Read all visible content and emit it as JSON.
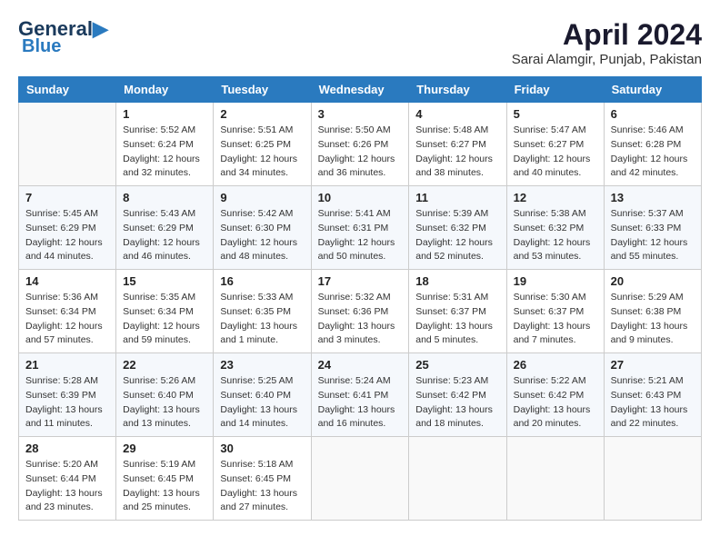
{
  "header": {
    "logo_line1": "General",
    "logo_line2": "Blue",
    "title": "April 2024",
    "subtitle": "Sarai Alamgir, Punjab, Pakistan"
  },
  "calendar": {
    "days_of_week": [
      "Sunday",
      "Monday",
      "Tuesday",
      "Wednesday",
      "Thursday",
      "Friday",
      "Saturday"
    ],
    "weeks": [
      [
        {
          "day": "",
          "info": ""
        },
        {
          "day": "1",
          "info": "Sunrise: 5:52 AM\nSunset: 6:24 PM\nDaylight: 12 hours\nand 32 minutes."
        },
        {
          "day": "2",
          "info": "Sunrise: 5:51 AM\nSunset: 6:25 PM\nDaylight: 12 hours\nand 34 minutes."
        },
        {
          "day": "3",
          "info": "Sunrise: 5:50 AM\nSunset: 6:26 PM\nDaylight: 12 hours\nand 36 minutes."
        },
        {
          "day": "4",
          "info": "Sunrise: 5:48 AM\nSunset: 6:27 PM\nDaylight: 12 hours\nand 38 minutes."
        },
        {
          "day": "5",
          "info": "Sunrise: 5:47 AM\nSunset: 6:27 PM\nDaylight: 12 hours\nand 40 minutes."
        },
        {
          "day": "6",
          "info": "Sunrise: 5:46 AM\nSunset: 6:28 PM\nDaylight: 12 hours\nand 42 minutes."
        }
      ],
      [
        {
          "day": "7",
          "info": "Sunrise: 5:45 AM\nSunset: 6:29 PM\nDaylight: 12 hours\nand 44 minutes."
        },
        {
          "day": "8",
          "info": "Sunrise: 5:43 AM\nSunset: 6:29 PM\nDaylight: 12 hours\nand 46 minutes."
        },
        {
          "day": "9",
          "info": "Sunrise: 5:42 AM\nSunset: 6:30 PM\nDaylight: 12 hours\nand 48 minutes."
        },
        {
          "day": "10",
          "info": "Sunrise: 5:41 AM\nSunset: 6:31 PM\nDaylight: 12 hours\nand 50 minutes."
        },
        {
          "day": "11",
          "info": "Sunrise: 5:39 AM\nSunset: 6:32 PM\nDaylight: 12 hours\nand 52 minutes."
        },
        {
          "day": "12",
          "info": "Sunrise: 5:38 AM\nSunset: 6:32 PM\nDaylight: 12 hours\nand 53 minutes."
        },
        {
          "day": "13",
          "info": "Sunrise: 5:37 AM\nSunset: 6:33 PM\nDaylight: 12 hours\nand 55 minutes."
        }
      ],
      [
        {
          "day": "14",
          "info": "Sunrise: 5:36 AM\nSunset: 6:34 PM\nDaylight: 12 hours\nand 57 minutes."
        },
        {
          "day": "15",
          "info": "Sunrise: 5:35 AM\nSunset: 6:34 PM\nDaylight: 12 hours\nand 59 minutes."
        },
        {
          "day": "16",
          "info": "Sunrise: 5:33 AM\nSunset: 6:35 PM\nDaylight: 13 hours\nand 1 minute."
        },
        {
          "day": "17",
          "info": "Sunrise: 5:32 AM\nSunset: 6:36 PM\nDaylight: 13 hours\nand 3 minutes."
        },
        {
          "day": "18",
          "info": "Sunrise: 5:31 AM\nSunset: 6:37 PM\nDaylight: 13 hours\nand 5 minutes."
        },
        {
          "day": "19",
          "info": "Sunrise: 5:30 AM\nSunset: 6:37 PM\nDaylight: 13 hours\nand 7 minutes."
        },
        {
          "day": "20",
          "info": "Sunrise: 5:29 AM\nSunset: 6:38 PM\nDaylight: 13 hours\nand 9 minutes."
        }
      ],
      [
        {
          "day": "21",
          "info": "Sunrise: 5:28 AM\nSunset: 6:39 PM\nDaylight: 13 hours\nand 11 minutes."
        },
        {
          "day": "22",
          "info": "Sunrise: 5:26 AM\nSunset: 6:40 PM\nDaylight: 13 hours\nand 13 minutes."
        },
        {
          "day": "23",
          "info": "Sunrise: 5:25 AM\nSunset: 6:40 PM\nDaylight: 13 hours\nand 14 minutes."
        },
        {
          "day": "24",
          "info": "Sunrise: 5:24 AM\nSunset: 6:41 PM\nDaylight: 13 hours\nand 16 minutes."
        },
        {
          "day": "25",
          "info": "Sunrise: 5:23 AM\nSunset: 6:42 PM\nDaylight: 13 hours\nand 18 minutes."
        },
        {
          "day": "26",
          "info": "Sunrise: 5:22 AM\nSunset: 6:42 PM\nDaylight: 13 hours\nand 20 minutes."
        },
        {
          "day": "27",
          "info": "Sunrise: 5:21 AM\nSunset: 6:43 PM\nDaylight: 13 hours\nand 22 minutes."
        }
      ],
      [
        {
          "day": "28",
          "info": "Sunrise: 5:20 AM\nSunset: 6:44 PM\nDaylight: 13 hours\nand 23 minutes."
        },
        {
          "day": "29",
          "info": "Sunrise: 5:19 AM\nSunset: 6:45 PM\nDaylight: 13 hours\nand 25 minutes."
        },
        {
          "day": "30",
          "info": "Sunrise: 5:18 AM\nSunset: 6:45 PM\nDaylight: 13 hours\nand 27 minutes."
        },
        {
          "day": "",
          "info": ""
        },
        {
          "day": "",
          "info": ""
        },
        {
          "day": "",
          "info": ""
        },
        {
          "day": "",
          "info": ""
        }
      ]
    ]
  }
}
